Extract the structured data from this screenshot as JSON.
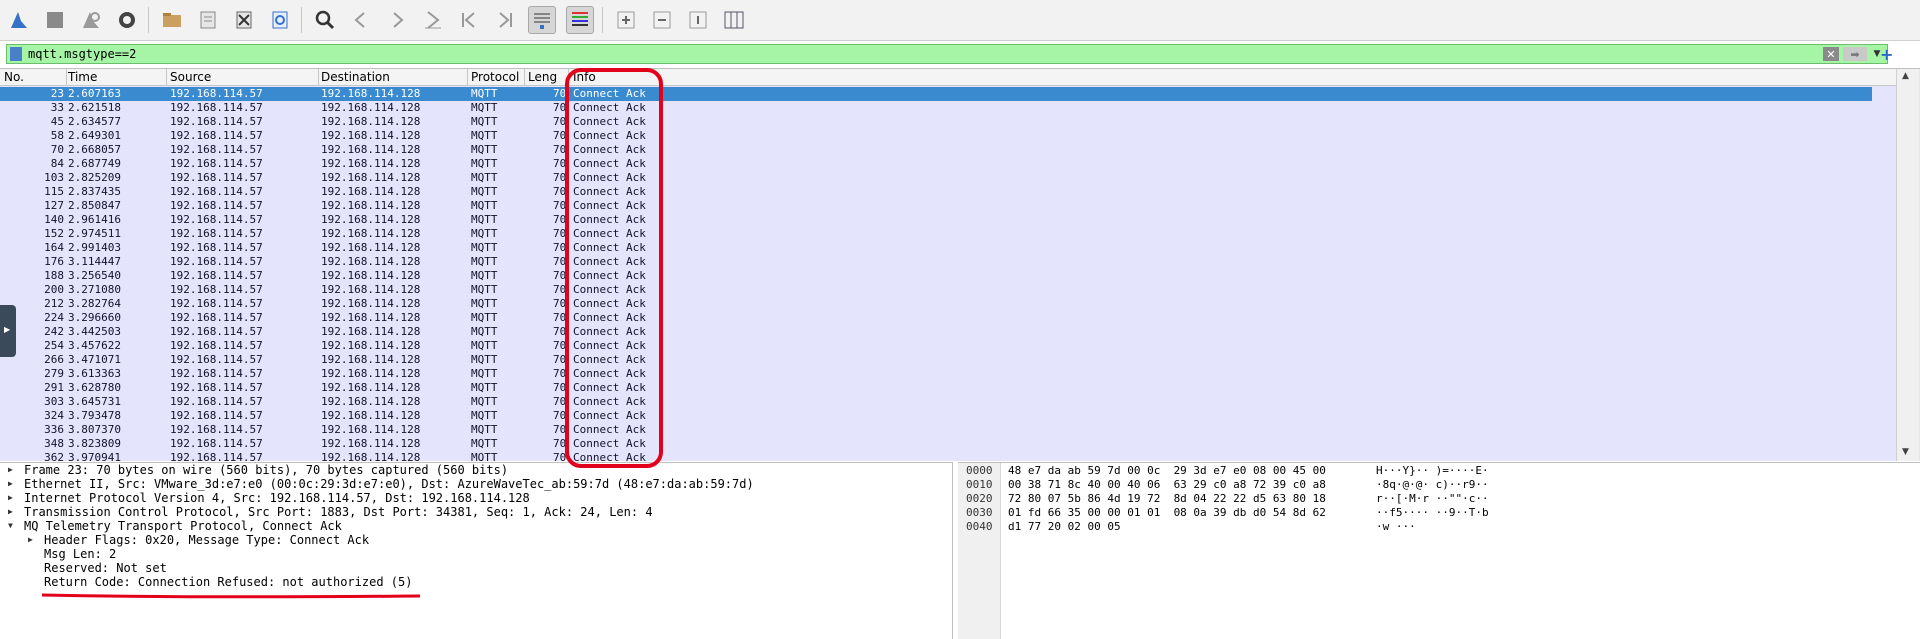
{
  "toolbar": {
    "buttons": [
      {
        "name": "shark-fin-icon"
      },
      {
        "name": "stop-icon"
      },
      {
        "name": "restart-icon"
      },
      {
        "name": "capture-options-icon"
      },
      {
        "name": "open-file-icon"
      },
      {
        "name": "save-file-icon"
      },
      {
        "name": "close-file-icon"
      },
      {
        "name": "reload-icon"
      },
      {
        "name": "find-icon"
      },
      {
        "name": "go-back-icon"
      },
      {
        "name": "go-forward-icon"
      },
      {
        "name": "go-to-packet-icon"
      },
      {
        "name": "first-packet-icon"
      },
      {
        "name": "last-packet-icon"
      },
      {
        "name": "autoscroll-icon"
      },
      {
        "name": "colorize-icon"
      },
      {
        "name": "zoom-in-icon"
      },
      {
        "name": "zoom-out-icon"
      },
      {
        "name": "normal-size-icon"
      },
      {
        "name": "resize-columns-icon"
      }
    ]
  },
  "filter": {
    "value": "mqtt.msgtype==2"
  },
  "packet_list": {
    "columns": [
      "No.",
      "Time",
      "Source",
      "Destination",
      "Protocol",
      "Leng",
      "Info"
    ],
    "rows": [
      {
        "no": "23",
        "time": "2.607163",
        "src": "192.168.114.57",
        "dst": "192.168.114.128",
        "proto": "MQTT",
        "len": "70",
        "info": "Connect Ack"
      },
      {
        "no": "33",
        "time": "2.621518",
        "src": "192.168.114.57",
        "dst": "192.168.114.128",
        "proto": "MQTT",
        "len": "70",
        "info": "Connect Ack"
      },
      {
        "no": "45",
        "time": "2.634577",
        "src": "192.168.114.57",
        "dst": "192.168.114.128",
        "proto": "MQTT",
        "len": "70",
        "info": "Connect Ack"
      },
      {
        "no": "58",
        "time": "2.649301",
        "src": "192.168.114.57",
        "dst": "192.168.114.128",
        "proto": "MQTT",
        "len": "70",
        "info": "Connect Ack"
      },
      {
        "no": "70",
        "time": "2.668057",
        "src": "192.168.114.57",
        "dst": "192.168.114.128",
        "proto": "MQTT",
        "len": "70",
        "info": "Connect Ack"
      },
      {
        "no": "84",
        "time": "2.687749",
        "src": "192.168.114.57",
        "dst": "192.168.114.128",
        "proto": "MQTT",
        "len": "70",
        "info": "Connect Ack"
      },
      {
        "no": "103",
        "time": "2.825209",
        "src": "192.168.114.57",
        "dst": "192.168.114.128",
        "proto": "MQTT",
        "len": "70",
        "info": "Connect Ack"
      },
      {
        "no": "115",
        "time": "2.837435",
        "src": "192.168.114.57",
        "dst": "192.168.114.128",
        "proto": "MQTT",
        "len": "70",
        "info": "Connect Ack"
      },
      {
        "no": "127",
        "time": "2.850847",
        "src": "192.168.114.57",
        "dst": "192.168.114.128",
        "proto": "MQTT",
        "len": "70",
        "info": "Connect Ack"
      },
      {
        "no": "140",
        "time": "2.961416",
        "src": "192.168.114.57",
        "dst": "192.168.114.128",
        "proto": "MQTT",
        "len": "70",
        "info": "Connect Ack"
      },
      {
        "no": "152",
        "time": "2.974511",
        "src": "192.168.114.57",
        "dst": "192.168.114.128",
        "proto": "MQTT",
        "len": "70",
        "info": "Connect Ack"
      },
      {
        "no": "164",
        "time": "2.991403",
        "src": "192.168.114.57",
        "dst": "192.168.114.128",
        "proto": "MQTT",
        "len": "70",
        "info": "Connect Ack"
      },
      {
        "no": "176",
        "time": "3.114447",
        "src": "192.168.114.57",
        "dst": "192.168.114.128",
        "proto": "MQTT",
        "len": "70",
        "info": "Connect Ack"
      },
      {
        "no": "188",
        "time": "3.256540",
        "src": "192.168.114.57",
        "dst": "192.168.114.128",
        "proto": "MQTT",
        "len": "70",
        "info": "Connect Ack"
      },
      {
        "no": "200",
        "time": "3.271080",
        "src": "192.168.114.57",
        "dst": "192.168.114.128",
        "proto": "MQTT",
        "len": "70",
        "info": "Connect Ack"
      },
      {
        "no": "212",
        "time": "3.282764",
        "src": "192.168.114.57",
        "dst": "192.168.114.128",
        "proto": "MQTT",
        "len": "70",
        "info": "Connect Ack"
      },
      {
        "no": "224",
        "time": "3.296660",
        "src": "192.168.114.57",
        "dst": "192.168.114.128",
        "proto": "MQTT",
        "len": "70",
        "info": "Connect Ack"
      },
      {
        "no": "242",
        "time": "3.442503",
        "src": "192.168.114.57",
        "dst": "192.168.114.128",
        "proto": "MQTT",
        "len": "70",
        "info": "Connect Ack"
      },
      {
        "no": "254",
        "time": "3.457622",
        "src": "192.168.114.57",
        "dst": "192.168.114.128",
        "proto": "MQTT",
        "len": "70",
        "info": "Connect Ack"
      },
      {
        "no": "266",
        "time": "3.471071",
        "src": "192.168.114.57",
        "dst": "192.168.114.128",
        "proto": "MQTT",
        "len": "70",
        "info": "Connect Ack"
      },
      {
        "no": "279",
        "time": "3.613363",
        "src": "192.168.114.57",
        "dst": "192.168.114.128",
        "proto": "MQTT",
        "len": "70",
        "info": "Connect Ack"
      },
      {
        "no": "291",
        "time": "3.628780",
        "src": "192.168.114.57",
        "dst": "192.168.114.128",
        "proto": "MQTT",
        "len": "70",
        "info": "Connect Ack"
      },
      {
        "no": "303",
        "time": "3.645731",
        "src": "192.168.114.57",
        "dst": "192.168.114.128",
        "proto": "MQTT",
        "len": "70",
        "info": "Connect Ack"
      },
      {
        "no": "324",
        "time": "3.793478",
        "src": "192.168.114.57",
        "dst": "192.168.114.128",
        "proto": "MQTT",
        "len": "70",
        "info": "Connect Ack"
      },
      {
        "no": "336",
        "time": "3.807370",
        "src": "192.168.114.57",
        "dst": "192.168.114.128",
        "proto": "MQTT",
        "len": "70",
        "info": "Connect Ack"
      },
      {
        "no": "348",
        "time": "3.823809",
        "src": "192.168.114.57",
        "dst": "192.168.114.128",
        "proto": "MQTT",
        "len": "70",
        "info": "Connect Ack"
      },
      {
        "no": "362",
        "time": "3.970941",
        "src": "192.168.114.57",
        "dst": "192.168.114.128",
        "proto": "MQTT",
        "len": "70",
        "info": "Connect Ack"
      }
    ]
  },
  "details": [
    {
      "text": "Frame 23: 70 bytes on wire (560 bits), 70 bytes captured (560 bits)",
      "expander": "collapsed"
    },
    {
      "text": "Ethernet II, Src: VMware_3d:e7:e0 (00:0c:29:3d:e7:e0), Dst: AzureWaveTec_ab:59:7d (48:e7:da:ab:59:7d)",
      "expander": "collapsed"
    },
    {
      "text": "Internet Protocol Version 4, Src: 192.168.114.57, Dst: 192.168.114.128",
      "expander": "collapsed"
    },
    {
      "text": "Transmission Control Protocol, Src Port: 1883, Dst Port: 34381, Seq: 1, Ack: 24, Len: 4",
      "expander": "collapsed"
    },
    {
      "text": "MQ Telemetry Transport Protocol, Connect Ack",
      "expander": "expanded"
    },
    {
      "text": "Header Flags: 0x20, Message Type: Connect Ack",
      "expander": "collapsed",
      "indent": 1
    },
    {
      "text": "Msg Len: 2",
      "expander": "none",
      "indent": 1
    },
    {
      "text": "Reserved: Not set",
      "expander": "none",
      "indent": 1
    },
    {
      "text": "Return Code: Connection Refused: not authorized (5)",
      "expander": "none",
      "indent": 1
    }
  ],
  "bytes": [
    {
      "offset": "0000",
      "hex": "48 e7 da ab 59 7d 00 0c  29 3d e7 e0 08 00 45 00",
      "ascii": "H···Y}·· )=····E·"
    },
    {
      "offset": "0010",
      "hex": "00 38 71 8c 40 00 40 06  63 29 c0 a8 72 39 c0 a8",
      "ascii": "·8q·@·@· c)··r9··"
    },
    {
      "offset": "0020",
      "hex": "72 80 07 5b 86 4d 19 72  8d 04 22 22 d5 63 80 18",
      "ascii": "r··[·M·r ··\"\"·c··"
    },
    {
      "offset": "0030",
      "hex": "01 fd 66 35 00 00 01 01  08 0a 39 db d0 54 8d 62",
      "ascii": "··f5···· ··9··T·b"
    },
    {
      "offset": "0040",
      "hex": "d1 77 20 02 00 05",
      "ascii": "·w ···"
    }
  ],
  "colors": {
    "selected_row": "#3a8ad0",
    "row_bg": "#e4e4fc",
    "filter_bg": "#a6f4a6",
    "annotation": "#e3001b"
  }
}
